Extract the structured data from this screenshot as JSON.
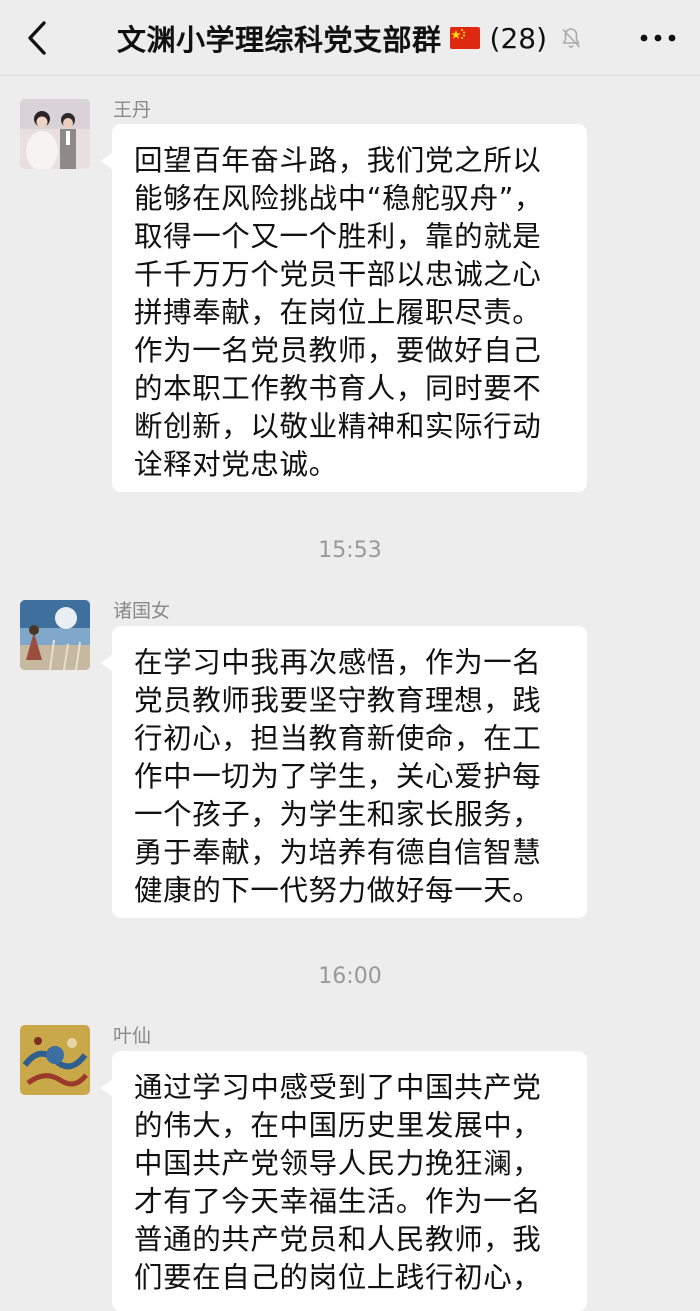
{
  "header": {
    "title": "文渊小学理综科党支部群",
    "member_count": "(28)"
  },
  "messages": [
    {
      "sender": "王丹",
      "text": "回望百年奋斗路，我们党之所以\n能够在风险挑战中“稳舵驭舟”，\n取得一个又一个胜利，靠的就是\n千千万万个党员干部以忠诚之心\n拼搏奉献，在岗位上履职尽责。\n作为一名党员教师，要做好自己\n的本职工作教书育人，同时要不\n断创新，以敬业精神和实际行动\n诠释对党忠诚。"
    },
    {
      "sender": "诸国女",
      "text": "在学习中我再次感悟，作为一名\n党员教师我要坚守教育理想，践\n行初心，担当教育新使命，在工\n作中一切为了学生，关心爱护每\n一个孩子，为学生和家长服务，\n勇于奉献，为培养有德自信智慧\n健康的下一代努力做好每一天。"
    },
    {
      "sender": "叶仙",
      "text": "通过学习中感受到了中国共产党\n的伟大，在中国历史里发展中，\n中国共产党领导人民力挽狂澜，\n才有了今天幸福生活。作为一名\n普通的共产党员和人民教师，我\n们要在自己的岗位上践行初心，"
    }
  ],
  "timestamps": [
    "15:53",
    "16:00"
  ]
}
